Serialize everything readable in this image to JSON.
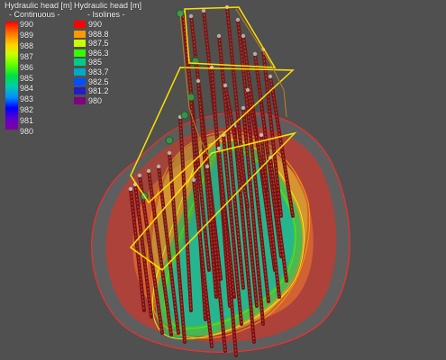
{
  "legend_continuous": {
    "title": "Hydraulic head [m]",
    "subtitle": "- Continuous -",
    "labels": [
      "990",
      "989",
      "988",
      "987",
      "986",
      "985",
      "984",
      "983",
      "982",
      "981",
      "980"
    ]
  },
  "legend_isolines": {
    "title": "Hydraulic head [m]",
    "subtitle": "- Isolines -",
    "items": [
      {
        "label": "990",
        "color": "#ff0000"
      },
      {
        "label": "988.8",
        "color": "#ff9900"
      },
      {
        "label": "987.5",
        "color": "#ccff00"
      },
      {
        "label": "986.3",
        "color": "#33ff00"
      },
      {
        "label": "985",
        "color": "#00cc88"
      },
      {
        "label": "983.7",
        "color": "#00a8cc"
      },
      {
        "label": "982.5",
        "color": "#0050ff"
      },
      {
        "label": "981.2",
        "color": "#2020c0"
      },
      {
        "label": "980",
        "color": "#800080"
      }
    ]
  },
  "colors": {
    "background": "#505050",
    "well": "#7a1010",
    "domain_outline": "#ff2020",
    "plane_edge": "#ffe000"
  }
}
